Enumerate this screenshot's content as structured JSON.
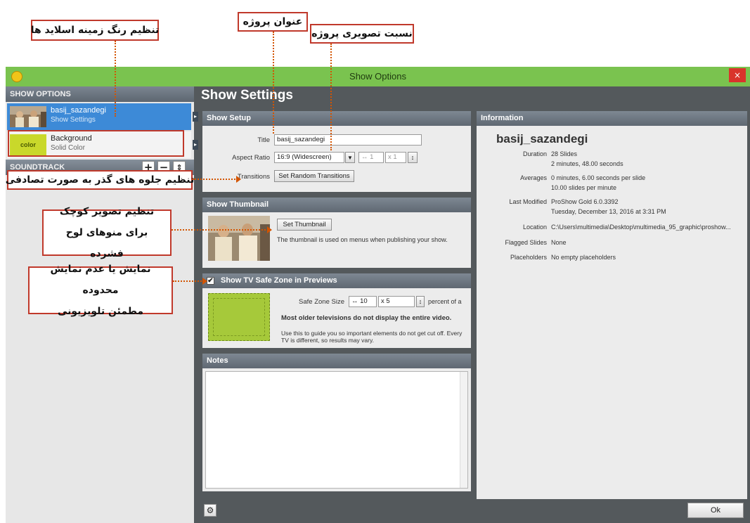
{
  "annotations": {
    "background_color": "تنظیم رنگ زمینه اسلاید ها",
    "project_title": "عنوان پروژه",
    "aspect_ratio": "نسبت تصویری پروژه",
    "transitions": "تنظیم جلوه های گذر به صورت تصادفی",
    "thumbnail_line1": "تنظیم تصویر کوچک",
    "thumbnail_line2": "برای منوهای لوح فشرده",
    "safe_zone_line1": "نمایش یا عدم نمایش محدوده",
    "safe_zone_line2": "مطمئن تلویزیونی"
  },
  "window": {
    "title": "Show Options",
    "close_label": "×"
  },
  "sidebar": {
    "header": "SHOW OPTIONS",
    "items": [
      {
        "title": "basij_sazandegi",
        "subtitle": "Show Settings"
      },
      {
        "title": "Background",
        "subtitle": "Solid Color",
        "thumb_label": "color"
      }
    ],
    "soundtrack": {
      "label": "SOUNDTRACK",
      "add": "+",
      "remove": "−",
      "move": "⇕"
    }
  },
  "main": {
    "title": "Show Settings",
    "show_setup": {
      "header": "Show Setup",
      "title_label": "Title",
      "title_value": "basij_sazandegi",
      "aspect_label": "Aspect Ratio",
      "aspect_value": "16:9 (Widescreen)",
      "aspect_w": "1",
      "aspect_h": "1",
      "transitions_label": "Transitions",
      "transitions_button": "Set Random Transitions"
    },
    "show_thumbnail": {
      "header": "Show Thumbnail",
      "button": "Set Thumbnail",
      "description": "The thumbnail is used on menus when publishing your show."
    },
    "safe_zone": {
      "header": "Show TV Safe Zone in Previews",
      "checked": true,
      "size_label": "Safe Zone Size",
      "x_value": "10",
      "y_value": "5",
      "percent_label": "percent of a",
      "bold_text": "Most older televisions do not display the entire video.",
      "description": "Use this to guide you so important elements do not get cut off. Every TV is different, so results may vary."
    },
    "notes": {
      "header": "Notes",
      "value": ""
    }
  },
  "information": {
    "header": "Information",
    "show_name": "basij_sazandegi",
    "duration_label": "Duration",
    "duration_line1": "28 Slides",
    "duration_line2": "2 minutes, 48.00 seconds",
    "averages_label": "Averages",
    "averages_line1": "0 minutes, 6.00 seconds per slide",
    "averages_line2": "10.00 slides per minute",
    "modified_label": "Last Modified",
    "modified_line1": "ProShow Gold 6.0.3392",
    "modified_line2": "Tuesday, December 13, 2016 at 3:31 PM",
    "location_label": "Location",
    "location_value": "C:\\Users\\multimedia\\Desktop\\multimedia_95_graphic\\proshow...",
    "flagged_label": "Flagged Slides",
    "flagged_value": "None",
    "placeholders_label": "Placeholders",
    "placeholders_value": "No empty placeholders"
  },
  "footer": {
    "ok_label": "Ok"
  },
  "colors": {
    "titlebar": "#7ac34f",
    "selected_item": "#3d8ad7",
    "callout_border": "#c0392b",
    "leader_line": "#d35400",
    "safe_zone_fill": "#a6c93a"
  }
}
